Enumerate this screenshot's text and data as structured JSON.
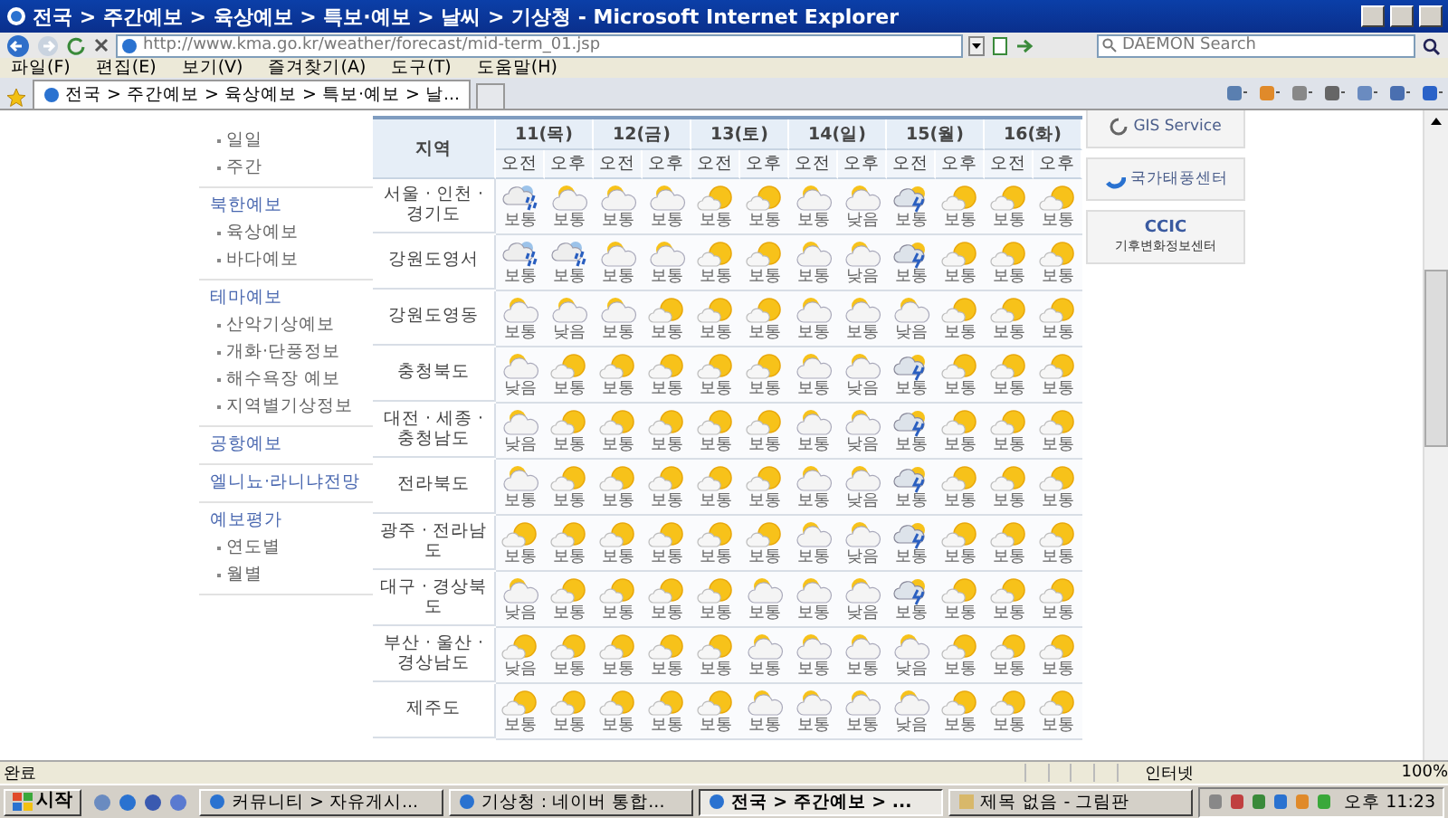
{
  "window": {
    "title": "전국 > 주간예보 > 육상예보 > 특보·예보 > 날씨 > 기상청 - Microsoft Internet Explorer"
  },
  "address_bar": {
    "url": "http://www.kma.go.kr/weather/forecast/mid-term_01.jsp",
    "search_placeholder": "DAEMON Search"
  },
  "menu": [
    "파일(F)",
    "편집(E)",
    "보기(V)",
    "즐겨찾기(A)",
    "도구(T)",
    "도움말(H)"
  ],
  "tabs": [
    {
      "label": "전국 > 주간예보 > 육상예보 > 특보·예보 > 날...",
      "selected": true
    }
  ],
  "sidebar": {
    "sections": [
      {
        "items": [
          "일일",
          "주간"
        ]
      },
      {
        "heading": "북한예보",
        "items": [
          "육상예보",
          "바다예보"
        ]
      },
      {
        "heading": "테마예보",
        "items": [
          "산악기상예보",
          "개화·단풍정보",
          "해수욕장 예보",
          "지역별기상정보"
        ]
      },
      {
        "heading": "공항예보"
      },
      {
        "heading": "엘니뇨·라니냐전망"
      },
      {
        "heading": "예보평가",
        "items": [
          "연도별",
          "월별"
        ]
      }
    ]
  },
  "forecast": {
    "region_header": "지역",
    "days": [
      "11(목)",
      "12(금)",
      "13(토)",
      "14(일)",
      "15(월)",
      "16(화)"
    ],
    "periods": [
      "오전",
      "오후",
      "오전",
      "오후",
      "오전",
      "오후",
      "오전",
      "오후",
      "오전",
      "오후",
      "오전",
      "오후"
    ],
    "rows": [
      {
        "region": "서울 · 인천 · 경기도",
        "cells": [
          {
            "kind": "rain",
            "text": "보통"
          },
          {
            "kind": "cloudy",
            "text": "보통"
          },
          {
            "kind": "cloudy",
            "text": "보통"
          },
          {
            "kind": "cloudy",
            "text": "보통"
          },
          {
            "kind": "partly",
            "text": "보통"
          },
          {
            "kind": "partly",
            "text": "보통"
          },
          {
            "kind": "cloudy",
            "text": "보통"
          },
          {
            "kind": "cloudy",
            "text": "낮음"
          },
          {
            "kind": "shower",
            "text": "보통"
          },
          {
            "kind": "partly",
            "text": "보통"
          },
          {
            "kind": "partly",
            "text": "보통"
          },
          {
            "kind": "partly",
            "text": "보통"
          }
        ]
      },
      {
        "region": "강원도영서",
        "cells": [
          {
            "kind": "rain",
            "text": "보통"
          },
          {
            "kind": "rain",
            "text": "보통"
          },
          {
            "kind": "cloudy",
            "text": "보통"
          },
          {
            "kind": "cloudy",
            "text": "보통"
          },
          {
            "kind": "partly",
            "text": "보통"
          },
          {
            "kind": "partly",
            "text": "보통"
          },
          {
            "kind": "cloudy",
            "text": "보통"
          },
          {
            "kind": "cloudy",
            "text": "낮음"
          },
          {
            "kind": "shower",
            "text": "보통"
          },
          {
            "kind": "partly",
            "text": "보통"
          },
          {
            "kind": "partly",
            "text": "보통"
          },
          {
            "kind": "partly",
            "text": "보통"
          }
        ]
      },
      {
        "region": "강원도영동",
        "cells": [
          {
            "kind": "cloudy",
            "text": "보통"
          },
          {
            "kind": "cloudy",
            "text": "낮음"
          },
          {
            "kind": "cloudy",
            "text": "보통"
          },
          {
            "kind": "partly",
            "text": "보통"
          },
          {
            "kind": "partly",
            "text": "보통"
          },
          {
            "kind": "partly",
            "text": "보통"
          },
          {
            "kind": "cloudy",
            "text": "보통"
          },
          {
            "kind": "cloudy",
            "text": "보통"
          },
          {
            "kind": "cloudy",
            "text": "낮음"
          },
          {
            "kind": "partly",
            "text": "보통"
          },
          {
            "kind": "partly",
            "text": "보통"
          },
          {
            "kind": "partly",
            "text": "보통"
          }
        ]
      },
      {
        "region": "충청북도",
        "cells": [
          {
            "kind": "cloudy",
            "text": "낮음"
          },
          {
            "kind": "partly",
            "text": "보통"
          },
          {
            "kind": "partly",
            "text": "보통"
          },
          {
            "kind": "partly",
            "text": "보통"
          },
          {
            "kind": "partly",
            "text": "보통"
          },
          {
            "kind": "partly",
            "text": "보통"
          },
          {
            "kind": "cloudy",
            "text": "보통"
          },
          {
            "kind": "cloudy",
            "text": "낮음"
          },
          {
            "kind": "shower",
            "text": "보통"
          },
          {
            "kind": "partly",
            "text": "보통"
          },
          {
            "kind": "partly",
            "text": "보통"
          },
          {
            "kind": "partly",
            "text": "보통"
          }
        ]
      },
      {
        "region": "대전 · 세종 · 충청남도",
        "cells": [
          {
            "kind": "cloudy",
            "text": "낮음"
          },
          {
            "kind": "partly",
            "text": "보통"
          },
          {
            "kind": "partly",
            "text": "보통"
          },
          {
            "kind": "partly",
            "text": "보통"
          },
          {
            "kind": "partly",
            "text": "보통"
          },
          {
            "kind": "partly",
            "text": "보통"
          },
          {
            "kind": "cloudy",
            "text": "보통"
          },
          {
            "kind": "cloudy",
            "text": "낮음"
          },
          {
            "kind": "shower",
            "text": "보통"
          },
          {
            "kind": "partly",
            "text": "보통"
          },
          {
            "kind": "partly",
            "text": "보통"
          },
          {
            "kind": "partly",
            "text": "보통"
          }
        ]
      },
      {
        "region": "전라북도",
        "cells": [
          {
            "kind": "cloudy",
            "text": "보통"
          },
          {
            "kind": "partly",
            "text": "보통"
          },
          {
            "kind": "partly",
            "text": "보통"
          },
          {
            "kind": "partly",
            "text": "보통"
          },
          {
            "kind": "partly",
            "text": "보통"
          },
          {
            "kind": "partly",
            "text": "보통"
          },
          {
            "kind": "cloudy",
            "text": "보통"
          },
          {
            "kind": "cloudy",
            "text": "낮음"
          },
          {
            "kind": "shower",
            "text": "보통"
          },
          {
            "kind": "partly",
            "text": "보통"
          },
          {
            "kind": "partly",
            "text": "보통"
          },
          {
            "kind": "partly",
            "text": "보통"
          }
        ]
      },
      {
        "region": "광주 · 전라남도",
        "cells": [
          {
            "kind": "partly",
            "text": "보통"
          },
          {
            "kind": "partly",
            "text": "보통"
          },
          {
            "kind": "partly",
            "text": "보통"
          },
          {
            "kind": "partly",
            "text": "보통"
          },
          {
            "kind": "partly",
            "text": "보통"
          },
          {
            "kind": "partly",
            "text": "보통"
          },
          {
            "kind": "cloudy",
            "text": "보통"
          },
          {
            "kind": "cloudy",
            "text": "낮음"
          },
          {
            "kind": "shower",
            "text": "보통"
          },
          {
            "kind": "partly",
            "text": "보통"
          },
          {
            "kind": "partly",
            "text": "보통"
          },
          {
            "kind": "partly",
            "text": "보통"
          }
        ]
      },
      {
        "region": "대구 · 경상북도",
        "cells": [
          {
            "kind": "cloudy",
            "text": "낮음"
          },
          {
            "kind": "partly",
            "text": "보통"
          },
          {
            "kind": "partly",
            "text": "보통"
          },
          {
            "kind": "partly",
            "text": "보통"
          },
          {
            "kind": "partly",
            "text": "보통"
          },
          {
            "kind": "cloudy",
            "text": "보통"
          },
          {
            "kind": "cloudy",
            "text": "보통"
          },
          {
            "kind": "cloudy",
            "text": "낮음"
          },
          {
            "kind": "shower",
            "text": "보통"
          },
          {
            "kind": "partly",
            "text": "보통"
          },
          {
            "kind": "partly",
            "text": "보통"
          },
          {
            "kind": "partly",
            "text": "보통"
          }
        ]
      },
      {
        "region": "부산 · 울산 · 경상남도",
        "cells": [
          {
            "kind": "partly",
            "text": "낮음"
          },
          {
            "kind": "partly",
            "text": "보통"
          },
          {
            "kind": "partly",
            "text": "보통"
          },
          {
            "kind": "partly",
            "text": "보통"
          },
          {
            "kind": "partly",
            "text": "보통"
          },
          {
            "kind": "cloudy",
            "text": "보통"
          },
          {
            "kind": "cloudy",
            "text": "보통"
          },
          {
            "kind": "cloudy",
            "text": "보통"
          },
          {
            "kind": "cloudy",
            "text": "낮음"
          },
          {
            "kind": "partly",
            "text": "보통"
          },
          {
            "kind": "partly",
            "text": "보통"
          },
          {
            "kind": "partly",
            "text": "보통"
          }
        ]
      },
      {
        "region": "제주도",
        "cells": [
          {
            "kind": "partly",
            "text": "보통"
          },
          {
            "kind": "partly",
            "text": "보통"
          },
          {
            "kind": "partly",
            "text": "보통"
          },
          {
            "kind": "partly",
            "text": "보통"
          },
          {
            "kind": "partly",
            "text": "보통"
          },
          {
            "kind": "cloudy",
            "text": "보통"
          },
          {
            "kind": "cloudy",
            "text": "보통"
          },
          {
            "kind": "cloudy",
            "text": "보통"
          },
          {
            "kind": "cloudy",
            "text": "낮음"
          },
          {
            "kind": "partly",
            "text": "보통"
          },
          {
            "kind": "partly",
            "text": "보통"
          },
          {
            "kind": "partly",
            "text": "보통"
          }
        ]
      }
    ]
  },
  "links": [
    {
      "kind": "gis",
      "text": "GIS Service"
    },
    {
      "kind": "typhoon",
      "text": "국가태풍센터"
    },
    {
      "kind": "ccic",
      "text": "CCIC",
      "subtext": "기후변화정보센터"
    }
  ],
  "status_bar": {
    "status": "완료",
    "zone": "인터넷",
    "zoom": "100%"
  },
  "taskbar": {
    "start": "시작",
    "tasks": [
      {
        "label": "커뮤니티 > 자유게시...",
        "selected": false
      },
      {
        "label": "기상청 : 네이버 통합...",
        "selected": false
      },
      {
        "label": "전국 > 주간예보 > ...",
        "selected": true
      },
      {
        "label": "제목 없음 - 그림판",
        "selected": false
      }
    ],
    "clock": "오후 11:23"
  }
}
